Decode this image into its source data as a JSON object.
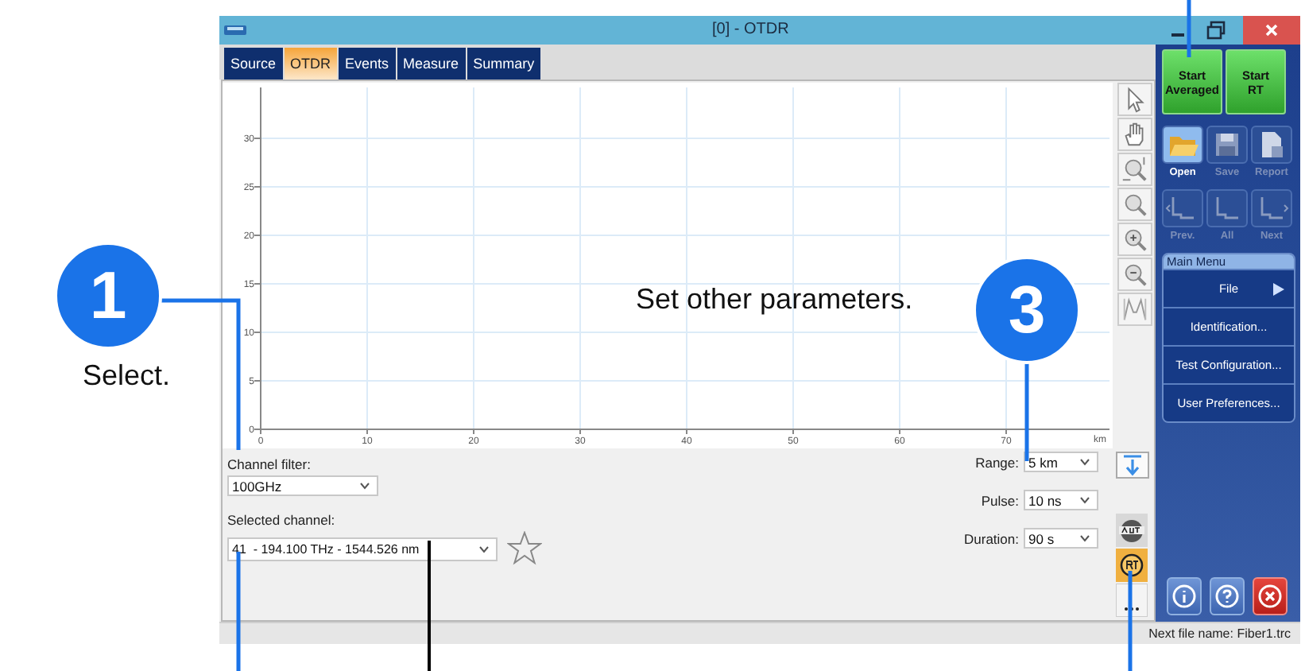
{
  "window": {
    "title": "[0] - OTDR"
  },
  "tabs": [
    {
      "label": "Source",
      "selected": false
    },
    {
      "label": "OTDR",
      "selected": true
    },
    {
      "label": "Events",
      "selected": false
    },
    {
      "label": "Measure",
      "selected": false
    },
    {
      "label": "Summary",
      "selected": false
    }
  ],
  "plot": {
    "yticks": [
      "30",
      "25",
      "20",
      "15",
      "10",
      "5",
      "0"
    ],
    "xticks": [
      "0",
      "10",
      "20",
      "30",
      "40",
      "50",
      "60",
      "70"
    ],
    "x_unit": "km"
  },
  "channel_settings": [
    {
      "label": "Channel filter:",
      "value": "100GHz"
    },
    {
      "label": "Selected channel:",
      "value": "41  - 194.100 THz - 1544.526 nm",
      "favorite": false
    }
  ],
  "acquisition_settings": [
    {
      "label": "Range:",
      "value": "5 km"
    },
    {
      "label": "Pulse:",
      "value": "10 ns"
    },
    {
      "label": "Duration:",
      "value": "90 s"
    }
  ],
  "side_panel": {
    "start_buttons": [
      "Start\nAveraged",
      "Start\nRT"
    ],
    "file_actions": [
      {
        "label": "Open",
        "disabled": false
      },
      {
        "label": "Save",
        "disabled": true
      },
      {
        "label": "Report",
        "disabled": true
      }
    ],
    "trace_nav": [
      {
        "label": "Prev.",
        "disabled": true
      },
      {
        "label": "All",
        "disabled": true
      },
      {
        "label": "Next",
        "disabled": true
      }
    ],
    "main_menu": {
      "title": "Main Menu",
      "items": [
        {
          "label": "File",
          "submenu": true
        },
        {
          "label": "Identification...",
          "submenu": false
        },
        {
          "label": "Test Configuration...",
          "submenu": false
        },
        {
          "label": "User Preferences...",
          "submenu": false
        }
      ]
    }
  },
  "status_bar": {
    "text": "Next file name: Fiber1.trc"
  },
  "callouts": [
    {
      "number": "1",
      "text": "Select."
    },
    {
      "number": "3",
      "text": "Set other parameters."
    }
  ]
}
